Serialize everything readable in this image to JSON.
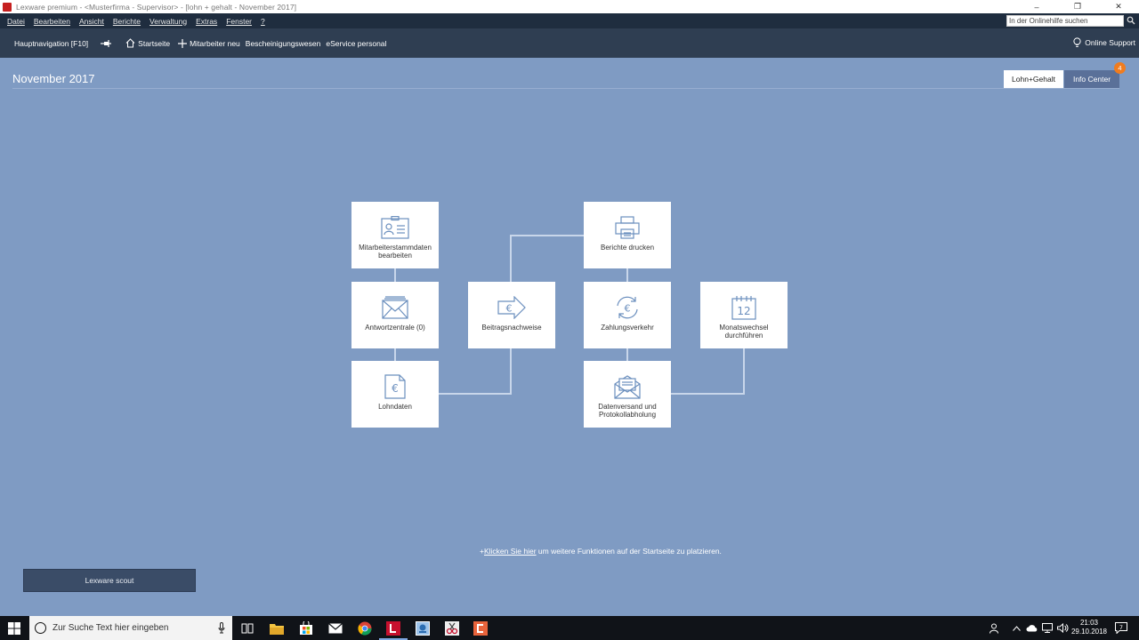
{
  "window": {
    "title": "Lexware premium - <Musterfirma - Supervisor> - [lohn + gehalt - November 2017]",
    "minimize": "–",
    "restore": "❐",
    "close": "✕"
  },
  "menu": {
    "items": [
      "Datei",
      "Bearbeiten",
      "Ansicht",
      "Berichte",
      "Verwaltung",
      "Extras",
      "Fenster",
      "?"
    ],
    "help_search_value": "In der Onlinehilfe suchen"
  },
  "nav": {
    "main": "Hauptnavigation [F10]",
    "startseite": "Startseite",
    "mitarbeiter_neu": "Mitarbeiter neu",
    "bescheinigungswesen": "Bescheinigungswesen",
    "eservice": "eService personal",
    "support": "Online Support"
  },
  "page": {
    "title": "November 2017",
    "tab_lohn": "Lohn+Gehalt",
    "tab_info": "Info Center",
    "info_badge": "4"
  },
  "tiles": {
    "mitarbeiter": "Mitarbeiterstammdaten bearbeiten",
    "antwort": "Antwortzentrale (0)",
    "lohndaten": "Lohndaten",
    "beitrag": "Beitragsnachweise",
    "berichte": "Berichte drucken",
    "zahlung": "Zahlungsverkehr",
    "datenversand": "Datenversand und Protokollabholung",
    "monatswechsel": "Monatswechsel durchführen",
    "calendar_day": "12"
  },
  "hint": {
    "link": "Klicken Sie hier",
    "rest": " um weitere Funktionen auf der Startseite zu platzieren."
  },
  "scout": "Lexware scout",
  "taskbar": {
    "search_placeholder": "Zur Suche Text hier eingeben",
    "time": "21:03",
    "date": "29.10.2018",
    "notifications": "7"
  },
  "colors": {
    "background": "#7f9bc3",
    "menubar": "#1f2d3f",
    "navbar": "#2f3e52",
    "badge": "#f07c1e",
    "icon_stroke": "#6b8fbe"
  }
}
